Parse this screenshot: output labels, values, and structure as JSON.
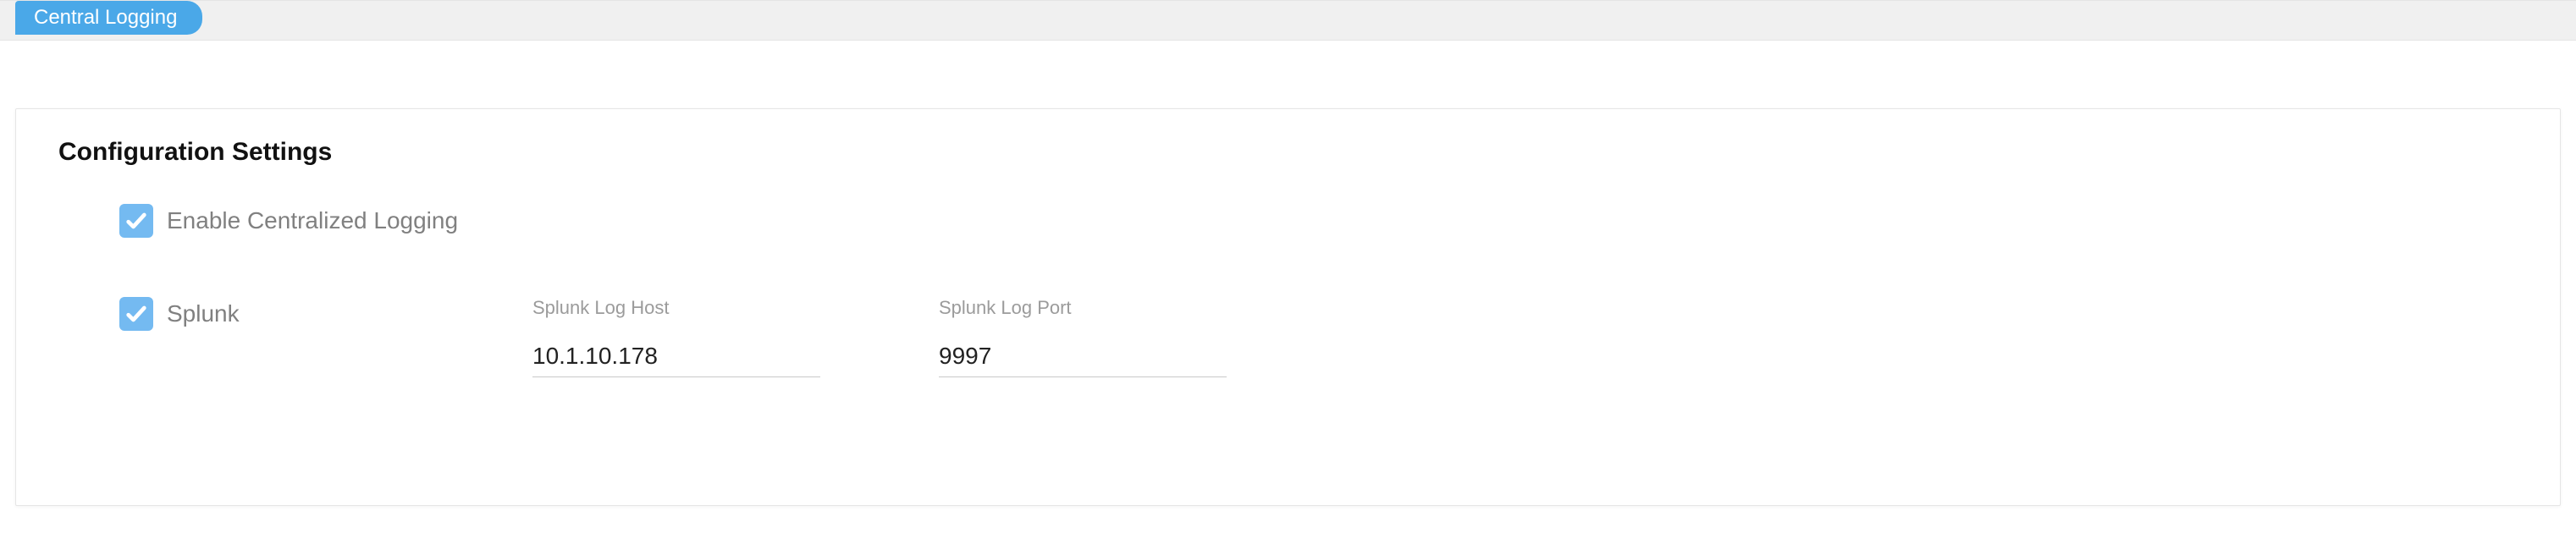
{
  "tab": {
    "label": "Central Logging"
  },
  "section": {
    "heading": "Configuration Settings"
  },
  "settings": {
    "enable_centralized_logging": {
      "label": "Enable Centralized Logging",
      "checked": true
    },
    "splunk": {
      "label": "Splunk",
      "checked": true,
      "host_label": "Splunk Log Host",
      "host_value": "10.1.10.178",
      "port_label": "Splunk Log Port",
      "port_value": "9997"
    }
  }
}
